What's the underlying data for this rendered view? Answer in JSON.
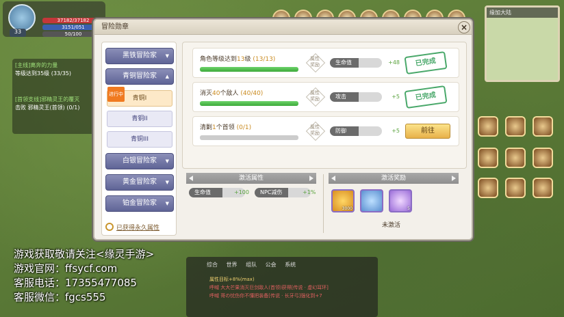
{
  "hud": {
    "player_level": "33",
    "hp": "37182/37182",
    "mp": "3151/051",
    "exp": "50/100",
    "location": "缘加大陆",
    "quest_tabs": [
      "任务",
      "组队"
    ],
    "quest_lines": [
      "[主线]离奔的力量",
      "等级达到35级 (33/35)",
      "[首领支线]邪精灵王的覆灭",
      "击败 邪精灵王(首领) (0/1)"
    ],
    "right_menu": [
      "强化",
      "背包",
      "称号",
      "技能",
      "设置",
      "功能预告",
      "飞行器",
      "成就",
      "排行",
      "装备库",
      "卡片",
      "公会"
    ],
    "chat_tabs": [
      "综合",
      "世界",
      "组队",
      "公会",
      "系统"
    ],
    "chat_lines": [
      "属性目标+8%(max)",
      "呼喊 大大芒果消灭巨剑敌人(首领)获得[传说 · 虚幻耳环]",
      "呼喊 哥の忧伤你不懂把装备[传说 · 长牙弓]强化到+7"
    ]
  },
  "dialog": {
    "title": "冒险勋章",
    "categories": [
      {
        "label": "黑铁冒险家"
      },
      {
        "label": "青铜冒险家"
      },
      {
        "label": "白银冒险家"
      },
      {
        "label": "黄金冒险家"
      },
      {
        "label": "铂金冒险家"
      }
    ],
    "in_progress_tag": "进行中",
    "subs": [
      "青铜I",
      "青铜II",
      "青铜III"
    ],
    "perm_link": "已获得永久属性",
    "reward_box_label": "属性奖励",
    "tasks": [
      {
        "prefix": "角色等级达到",
        "hl": "13",
        "suffix": "级",
        "count": "(13/13)",
        "progress": 1.0,
        "attr": "生命值",
        "value": "+48",
        "status": "已完成"
      },
      {
        "prefix": "消灭",
        "hl": "40",
        "suffix": "个敌人",
        "count": "(40/40)",
        "progress": 1.0,
        "attr": "攻击",
        "value": "+5",
        "status": "已完成"
      },
      {
        "prefix": "清剿",
        "hl": "1",
        "suffix": "个首领",
        "count": "(0/1)",
        "progress": 0.0,
        "attr": "防御",
        "value": "+5",
        "status": "前往"
      }
    ],
    "activate_attr": {
      "title": "激活属性",
      "items": [
        {
          "label": "生命值",
          "value": "+100"
        },
        {
          "label": "NPC减伤",
          "value": "+1%"
        }
      ]
    },
    "activate_reward": {
      "title": "激活奖励",
      "items": [
        {
          "name": "gold",
          "qty": "3000"
        },
        {
          "name": "magnifier",
          "qty": ""
        },
        {
          "name": "crystal",
          "qty": "5"
        }
      ],
      "status": "未激活"
    }
  },
  "watermark": [
    "游戏获取敬请关注<缘灵手游>",
    "游戏官网：ffsycf.com",
    "客服电话：17355477085",
    "客服微信：fgcs555"
  ]
}
